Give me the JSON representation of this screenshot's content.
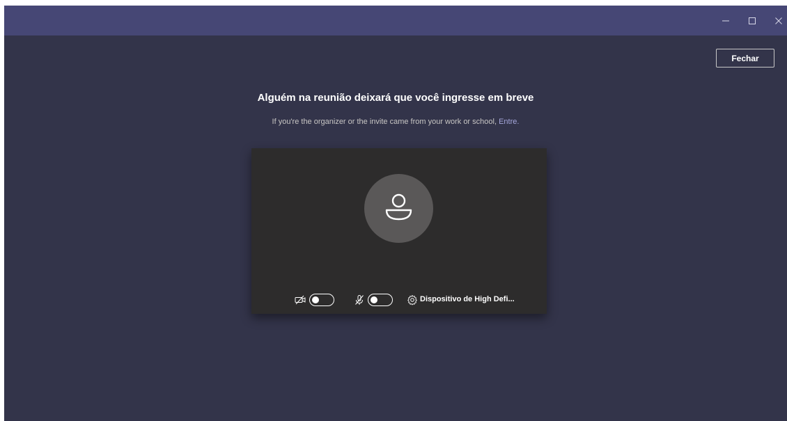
{
  "window": {
    "controls": {
      "minimize_icon": "minimize-icon",
      "maximize_icon": "maximize-icon",
      "close_icon": "close-icon"
    }
  },
  "header": {
    "close_button_label": "Fechar"
  },
  "main": {
    "title": "Alguém na reunião deixará que você ingresse em breve",
    "subtitle_text": "If you're the organizer or the invite came from your work or school,",
    "signin_link": "Entre."
  },
  "preview": {
    "avatar_icon": "person-icon",
    "camera": {
      "icon": "camera-off-icon",
      "enabled": false
    },
    "microphone": {
      "icon": "mic-off-icon",
      "enabled": false
    },
    "device": {
      "icon": "gear-icon",
      "label": "Dispositivo de High Defi..."
    }
  },
  "colors": {
    "titlebar": "#464775",
    "background": "#33344a",
    "preview_panel": "#2d2c2c",
    "avatar_circle": "#5a5858",
    "link": "#a6a7dc"
  }
}
